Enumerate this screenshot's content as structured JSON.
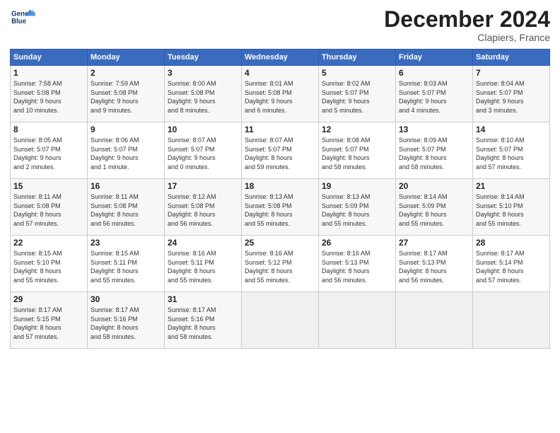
{
  "logo": {
    "text_line1": "General",
    "text_line2": "Blue"
  },
  "header": {
    "month": "December 2024",
    "location": "Clapiers, France"
  },
  "days_of_week": [
    "Sunday",
    "Monday",
    "Tuesday",
    "Wednesday",
    "Thursday",
    "Friday",
    "Saturday"
  ],
  "weeks": [
    [
      {
        "day": "1",
        "sunrise": "7:58 AM",
        "sunset": "5:08 PM",
        "daylight": "9 hours and 10 minutes."
      },
      {
        "day": "2",
        "sunrise": "7:59 AM",
        "sunset": "5:08 PM",
        "daylight": "9 hours and 9 minutes."
      },
      {
        "day": "3",
        "sunrise": "8:00 AM",
        "sunset": "5:08 PM",
        "daylight": "9 hours and 8 minutes."
      },
      {
        "day": "4",
        "sunrise": "8:01 AM",
        "sunset": "5:08 PM",
        "daylight": "9 hours and 6 minutes."
      },
      {
        "day": "5",
        "sunrise": "8:02 AM",
        "sunset": "5:07 PM",
        "daylight": "9 hours and 5 minutes."
      },
      {
        "day": "6",
        "sunrise": "8:03 AM",
        "sunset": "5:07 PM",
        "daylight": "9 hours and 4 minutes."
      },
      {
        "day": "7",
        "sunrise": "8:04 AM",
        "sunset": "5:07 PM",
        "daylight": "9 hours and 3 minutes."
      }
    ],
    [
      {
        "day": "8",
        "sunrise": "8:05 AM",
        "sunset": "5:07 PM",
        "daylight": "9 hours and 2 minutes."
      },
      {
        "day": "9",
        "sunrise": "8:06 AM",
        "sunset": "5:07 PM",
        "daylight": "9 hours and 1 minute."
      },
      {
        "day": "10",
        "sunrise": "8:07 AM",
        "sunset": "5:07 PM",
        "daylight": "9 hours and 0 minutes."
      },
      {
        "day": "11",
        "sunrise": "8:07 AM",
        "sunset": "5:07 PM",
        "daylight": "8 hours and 59 minutes."
      },
      {
        "day": "12",
        "sunrise": "8:08 AM",
        "sunset": "5:07 PM",
        "daylight": "8 hours and 58 minutes."
      },
      {
        "day": "13",
        "sunrise": "8:09 AM",
        "sunset": "5:07 PM",
        "daylight": "8 hours and 58 minutes."
      },
      {
        "day": "14",
        "sunrise": "8:10 AM",
        "sunset": "5:07 PM",
        "daylight": "8 hours and 57 minutes."
      }
    ],
    [
      {
        "day": "15",
        "sunrise": "8:11 AM",
        "sunset": "5:08 PM",
        "daylight": "8 hours and 57 minutes."
      },
      {
        "day": "16",
        "sunrise": "8:11 AM",
        "sunset": "5:08 PM",
        "daylight": "8 hours and 56 minutes."
      },
      {
        "day": "17",
        "sunrise": "8:12 AM",
        "sunset": "5:08 PM",
        "daylight": "8 hours and 56 minutes."
      },
      {
        "day": "18",
        "sunrise": "8:13 AM",
        "sunset": "5:08 PM",
        "daylight": "8 hours and 55 minutes."
      },
      {
        "day": "19",
        "sunrise": "8:13 AM",
        "sunset": "5:09 PM",
        "daylight": "8 hours and 55 minutes."
      },
      {
        "day": "20",
        "sunrise": "8:14 AM",
        "sunset": "5:09 PM",
        "daylight": "8 hours and 55 minutes."
      },
      {
        "day": "21",
        "sunrise": "8:14 AM",
        "sunset": "5:10 PM",
        "daylight": "8 hours and 55 minutes."
      }
    ],
    [
      {
        "day": "22",
        "sunrise": "8:15 AM",
        "sunset": "5:10 PM",
        "daylight": "8 hours and 55 minutes."
      },
      {
        "day": "23",
        "sunrise": "8:15 AM",
        "sunset": "5:11 PM",
        "daylight": "8 hours and 55 minutes."
      },
      {
        "day": "24",
        "sunrise": "8:16 AM",
        "sunset": "5:11 PM",
        "daylight": "8 hours and 55 minutes."
      },
      {
        "day": "25",
        "sunrise": "8:16 AM",
        "sunset": "5:12 PM",
        "daylight": "8 hours and 55 minutes."
      },
      {
        "day": "26",
        "sunrise": "8:16 AM",
        "sunset": "5:13 PM",
        "daylight": "8 hours and 56 minutes."
      },
      {
        "day": "27",
        "sunrise": "8:17 AM",
        "sunset": "5:13 PM",
        "daylight": "8 hours and 56 minutes."
      },
      {
        "day": "28",
        "sunrise": "8:17 AM",
        "sunset": "5:14 PM",
        "daylight": "8 hours and 57 minutes."
      }
    ],
    [
      {
        "day": "29",
        "sunrise": "8:17 AM",
        "sunset": "5:15 PM",
        "daylight": "8 hours and 57 minutes."
      },
      {
        "day": "30",
        "sunrise": "8:17 AM",
        "sunset": "5:16 PM",
        "daylight": "8 hours and 58 minutes."
      },
      {
        "day": "31",
        "sunrise": "8:17 AM",
        "sunset": "5:16 PM",
        "daylight": "8 hours and 58 minutes."
      },
      null,
      null,
      null,
      null
    ]
  ]
}
